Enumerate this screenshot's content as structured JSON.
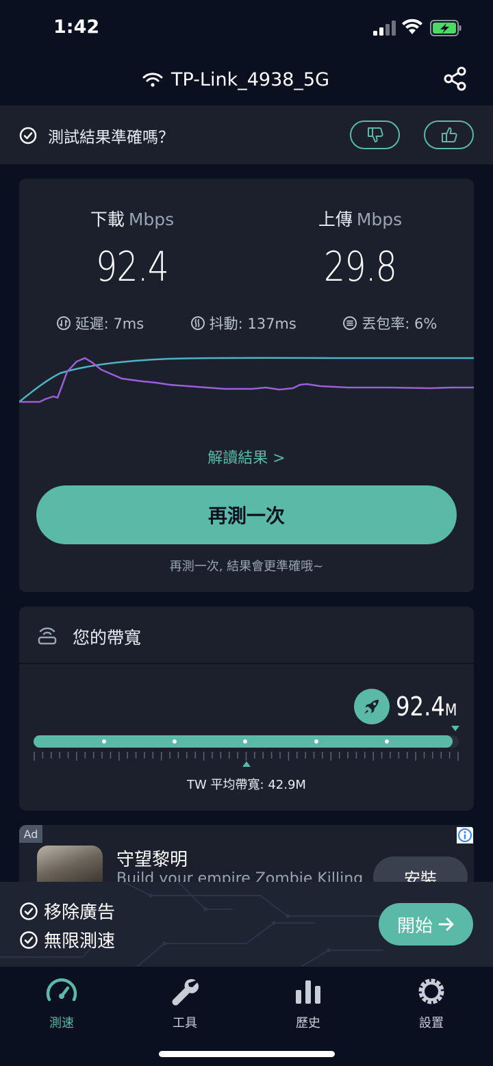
{
  "status_bar": {
    "time": "1:42"
  },
  "header": {
    "network_name": "TP-Link_4938_5G"
  },
  "feedback": {
    "question": "測試結果準確嗎？"
  },
  "result": {
    "download_label": "下載",
    "upload_label": "上傳",
    "unit": "Mbps",
    "download_value": "92.4",
    "upload_value": "29.8",
    "latency": "延遲: 7ms",
    "jitter": "抖動: 137ms",
    "packet_loss": "丟包率: 6%",
    "interpret_link": "解讀結果 >",
    "retest_button": "再測一次",
    "retest_hint": "再測一次, 結果會更準確哦~"
  },
  "bandwidth": {
    "title": "您的帶寬",
    "speed_value": "92.4",
    "speed_suffix": "M",
    "fill_fraction": 0.985,
    "average_label": "TW 平均帶寬: 42.9M"
  },
  "ad": {
    "tag": "Ad",
    "title": "守望黎明",
    "subtitle": "Build your empire Zombie Killing",
    "install_button": "安裝"
  },
  "promo": {
    "item1": "移除廣告",
    "item2": "無限測速",
    "start_button": "開始"
  },
  "tabs": [
    {
      "label": "測速",
      "icon": "speedometer-icon",
      "active": true
    },
    {
      "label": "工具",
      "icon": "wrench-icon",
      "active": false
    },
    {
      "label": "歷史",
      "icon": "bar-chart-icon",
      "active": false
    },
    {
      "label": "設置",
      "icon": "gear-icon",
      "active": false
    }
  ],
  "colors": {
    "accent": "#5ab9a7",
    "background": "#0b1020",
    "card": "#1b202c",
    "download_line": "#4fb3c2",
    "upload_line": "#9b5fd6"
  }
}
